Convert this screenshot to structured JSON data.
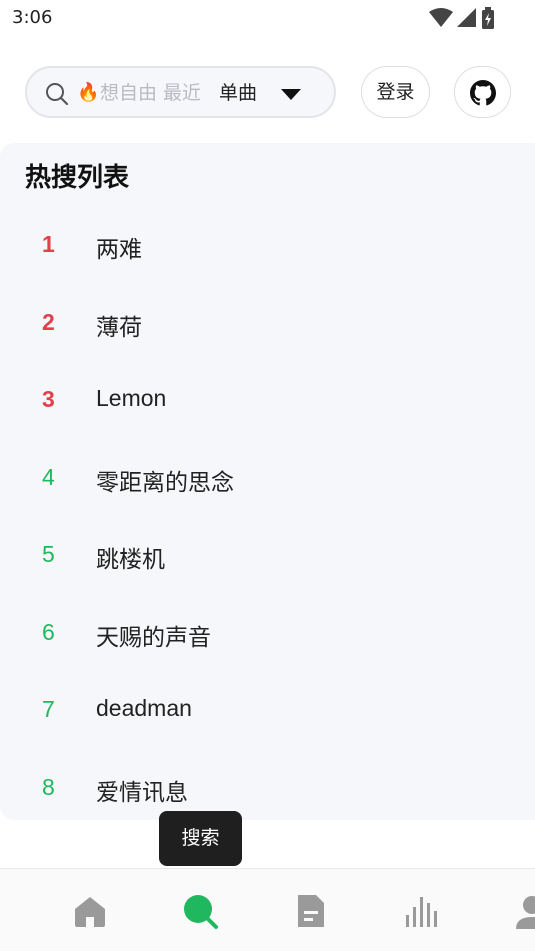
{
  "status": {
    "time": "3:06"
  },
  "search": {
    "placeholder": "想自由 最近",
    "fire_icon": "fire-icon",
    "type_selected": "单曲"
  },
  "header": {
    "login_label": "登录",
    "github_icon": "github-icon"
  },
  "hot": {
    "title": "热搜列表",
    "items": [
      {
        "rank": "1",
        "name": "两难"
      },
      {
        "rank": "2",
        "name": "薄荷"
      },
      {
        "rank": "3",
        "name": "Lemon"
      },
      {
        "rank": "4",
        "name": "零距离的思念"
      },
      {
        "rank": "5",
        "name": "跳楼机"
      },
      {
        "rank": "6",
        "name": "天赐的声音"
      },
      {
        "rank": "7",
        "name": "deadman"
      },
      {
        "rank": "8",
        "name": "爱情讯息"
      }
    ]
  },
  "tooltip": {
    "text": "搜索"
  },
  "colors": {
    "accent": "#1fb85e",
    "top_rank": "#e2404b",
    "nav_inactive": "#9a9a9a"
  },
  "nav": {
    "items": [
      "home-icon",
      "search-icon",
      "document-icon",
      "chart-icon",
      "user-icon"
    ],
    "active": "search-icon"
  }
}
